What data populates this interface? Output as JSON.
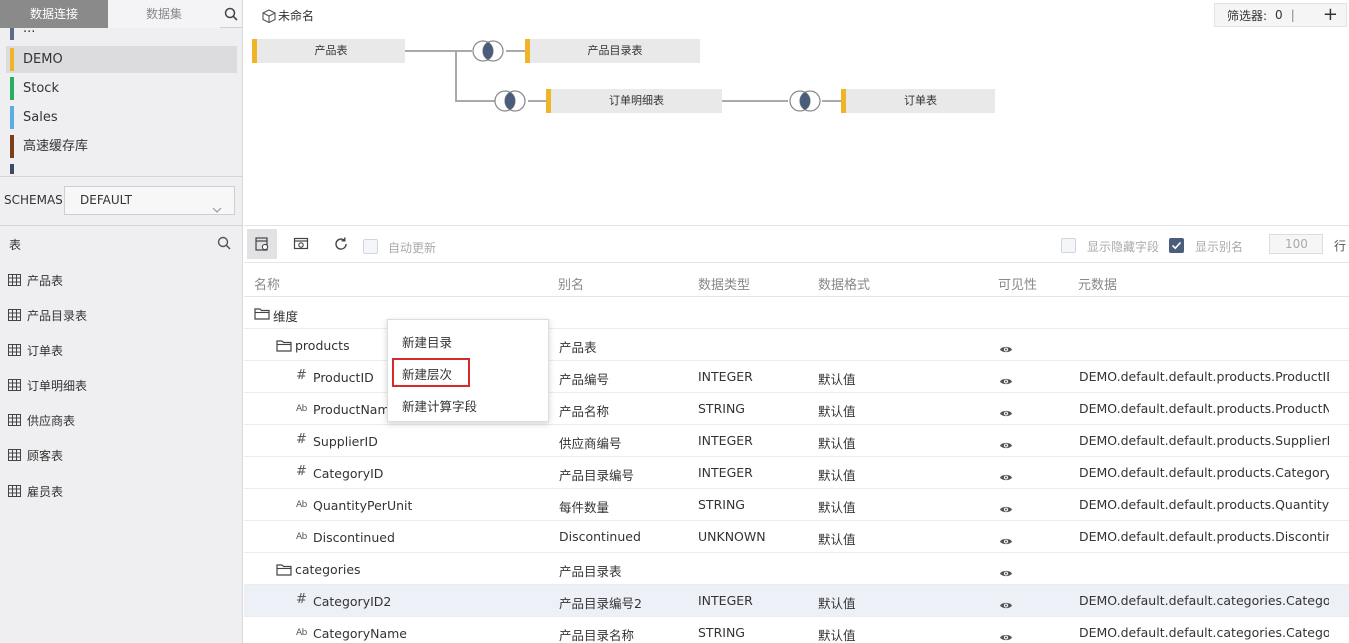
{
  "sidebar": {
    "tabs": [
      {
        "label": "数据连接"
      },
      {
        "label": "数据集"
      }
    ],
    "datasources": [
      {
        "label": "...",
        "color": "#5b6b88"
      },
      {
        "label": "DEMO",
        "color": "#f0b429",
        "selected": true
      },
      {
        "label": "Stock",
        "color": "#27ae60"
      },
      {
        "label": "Sales",
        "color": "#5dade2"
      },
      {
        "label": "高速缓存库",
        "color": "#7b3f1d"
      },
      {
        "label": "...",
        "color": "#3c4a66"
      }
    ],
    "schemas": {
      "label": "SCHEMAS",
      "value": "DEFAULT"
    },
    "tables_label": "表",
    "tables": [
      {
        "label": "产品表"
      },
      {
        "label": "产品目录表"
      },
      {
        "label": "订单表"
      },
      {
        "label": "订单明细表"
      },
      {
        "label": "供应商表"
      },
      {
        "label": "顾客表"
      },
      {
        "label": "雇员表"
      }
    ]
  },
  "diagram": {
    "title": "未命名",
    "filter_label": "筛选器:",
    "filter_count": "0",
    "filter_sep": "|",
    "nodes": [
      {
        "label": "产品表"
      },
      {
        "label": "产品目录表"
      },
      {
        "label": "订单明细表"
      },
      {
        "label": "订单表"
      }
    ]
  },
  "toolbar": {
    "auto_update_label": "自动更新",
    "show_hidden_label": "显示隐藏字段",
    "show_alias_label": "显示别名",
    "rows_value": "100",
    "rows_unit": "行",
    "auto_update_checked": false,
    "show_hidden_checked": false,
    "show_alias_checked": true
  },
  "grid": {
    "columns": {
      "name": "名称",
      "alias": "别名",
      "type": "数据类型",
      "format": "数据格式",
      "visibility": "可见性",
      "meta": "元数据"
    },
    "rows": [
      {
        "kind": "folder",
        "level": 0,
        "name": "维度",
        "alias": "",
        "type": "",
        "format": "",
        "visible": false,
        "meta": ""
      },
      {
        "kind": "folder",
        "level": 1,
        "name": "products",
        "alias": "产品表",
        "type": "",
        "format": "",
        "visible": true,
        "meta": ""
      },
      {
        "kind": "num",
        "level": 2,
        "name": "ProductID",
        "alias": "产品编号",
        "type": "INTEGER",
        "format": "默认值",
        "visible": true,
        "meta": "DEMO.default.default.products.ProductID"
      },
      {
        "kind": "str",
        "level": 2,
        "name": "ProductName",
        "alias": "产品名称",
        "type": "STRING",
        "format": "默认值",
        "visible": true,
        "meta": "DEMO.default.default.products.ProductN..."
      },
      {
        "kind": "num",
        "level": 2,
        "name": "SupplierID",
        "alias": "供应商编号",
        "type": "INTEGER",
        "format": "默认值",
        "visible": true,
        "meta": "DEMO.default.default.products.SupplierID"
      },
      {
        "kind": "num",
        "level": 2,
        "name": "CategoryID",
        "alias": "产品目录编号",
        "type": "INTEGER",
        "format": "默认值",
        "visible": true,
        "meta": "DEMO.default.default.products.CategoryID"
      },
      {
        "kind": "str",
        "level": 2,
        "name": "QuantityPerUnit",
        "alias": "每件数量",
        "type": "STRING",
        "format": "默认值",
        "visible": true,
        "meta": "DEMO.default.default.products.QuantityP..."
      },
      {
        "kind": "str",
        "level": 2,
        "name": "Discontinued",
        "alias": "Discontinued",
        "type": "UNKNOWN",
        "format": "默认值",
        "visible": true,
        "meta": "DEMO.default.default.products.Discontin..."
      },
      {
        "kind": "folder",
        "level": 1,
        "name": "categories",
        "alias": "产品目录表",
        "type": "",
        "format": "",
        "visible": true,
        "meta": ""
      },
      {
        "kind": "num",
        "level": 2,
        "name": "CategoryID2",
        "alias": "产品目录编号2",
        "type": "INTEGER",
        "format": "默认值",
        "visible": true,
        "meta": "DEMO.default.default.categories.Categor...",
        "selected": true
      },
      {
        "kind": "str",
        "level": 2,
        "name": "CategoryName",
        "alias": "产品目录名称",
        "type": "STRING",
        "format": "默认值",
        "visible": true,
        "meta": "DEMO.default.default.categories.Categor..."
      }
    ]
  },
  "context_menu": {
    "items": [
      {
        "label": "新建目录"
      },
      {
        "label": "新建层次",
        "highlighted": true
      },
      {
        "label": "新建计算字段"
      }
    ],
    "highlight_color": "#d52b2b"
  },
  "colors": {
    "accent_node": "#f0b429",
    "join_fill": "#4a5d7a"
  }
}
